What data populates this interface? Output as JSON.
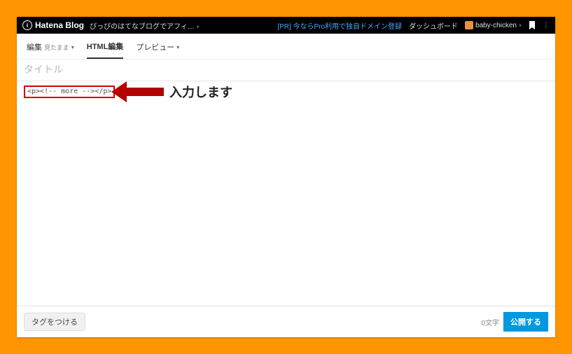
{
  "topbar": {
    "logo": "Hatena Blog",
    "blog_name": "ぴっぴのはてなブログでアフィ…",
    "promo": "[PR] 今ならPro利用で独自ドメイン登録",
    "dashboard": "ダッシュボード",
    "username": "baby-chicken"
  },
  "tabs": {
    "edit_label": "編集",
    "edit_sub": "見たまま",
    "html_label": "HTML編集",
    "preview_label": "プレビュー"
  },
  "editor": {
    "title_placeholder": "タイトル",
    "code_snippet": "<p><!-- more --></p>"
  },
  "annotation": {
    "text": "入力します"
  },
  "footer": {
    "tag_label": "タグをつける",
    "char_count": "0文字",
    "publish_label": "公開する"
  },
  "colors": {
    "accent_blue": "#0099e0",
    "highlight_red": "#d40000",
    "page_bg": "#ff9500"
  }
}
